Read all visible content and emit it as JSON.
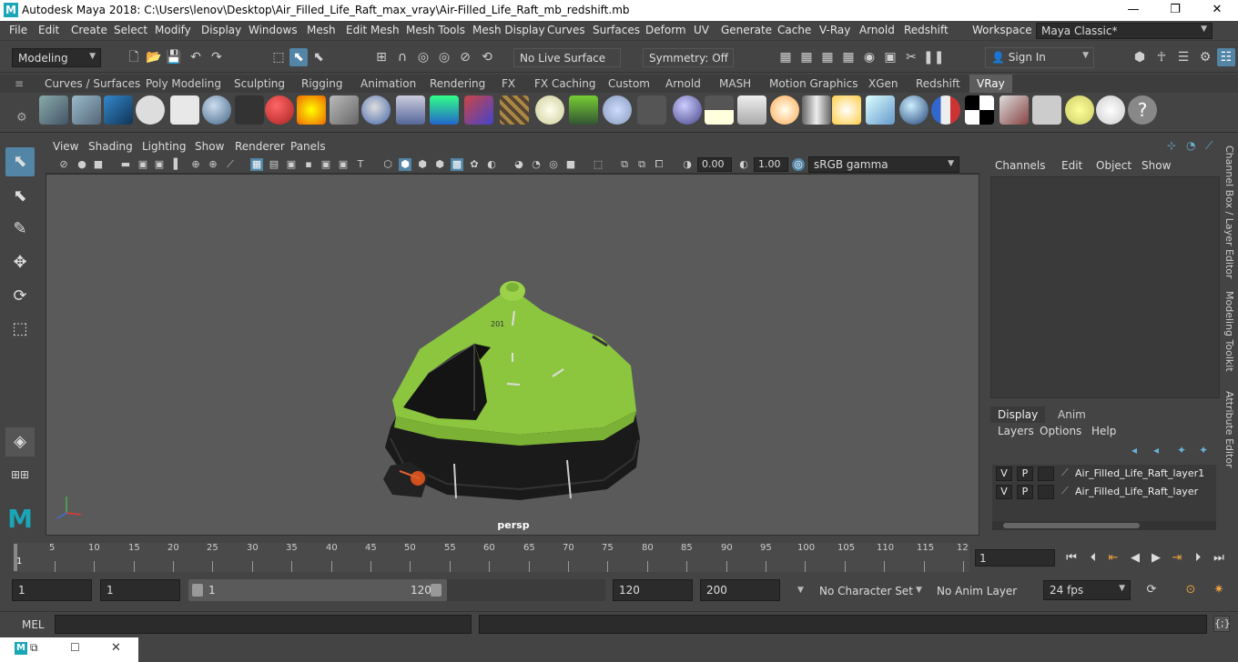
{
  "window": {
    "title": "Autodesk Maya 2018: C:\\Users\\lenov\\Desktop\\Air_Filled_Life_Raft_max_vray\\Air-Filled_Life_Raft_mb_redshift.mb",
    "logo": "M",
    "minimize": "—",
    "restore": "❐",
    "close": "✕"
  },
  "menubar": {
    "items": [
      "File",
      "Edit",
      "Create",
      "Select",
      "Modify",
      "Display",
      "Windows",
      "Mesh",
      "Edit Mesh",
      "Mesh Tools",
      "Mesh Display",
      "Curves",
      "Surfaces",
      "Deform",
      "UV",
      "Generate",
      "Cache",
      "V-Ray",
      "Arnold",
      "Redshift"
    ],
    "workspace_label": "Workspace :",
    "workspace_value": "Maya Classic*"
  },
  "statusline": {
    "mode": "Modeling",
    "live_surface": "No Live Surface",
    "symmetry": "Symmetry: Off",
    "sign_in": "Sign In"
  },
  "shelf": {
    "tabs": [
      "Curves / Surfaces",
      "Poly Modeling",
      "Sculpting",
      "Rigging",
      "Animation",
      "Rendering",
      "FX",
      "FX Caching",
      "Custom",
      "Arnold",
      "MASH",
      "Motion Graphics",
      "XGen",
      "Redshift",
      "VRay"
    ],
    "active_tab": "VRay"
  },
  "viewport": {
    "menus": [
      "View",
      "Shading",
      "Lighting",
      "Show",
      "Renderer",
      "Panels"
    ],
    "exposure": "0.00",
    "gamma": "1.00",
    "color_space": "sRGB gamma",
    "camera_label": "persp",
    "model_label": "201"
  },
  "channelbox": {
    "menus": [
      "Channels",
      "Edit",
      "Object",
      "Show"
    ]
  },
  "layers": {
    "tabs": [
      "Display",
      "Anim"
    ],
    "menus": [
      "Layers",
      "Options",
      "Help"
    ],
    "rows": [
      {
        "v": "V",
        "p": "P",
        "name": "Air_Filled_Life_Raft_layer1"
      },
      {
        "v": "V",
        "p": "P",
        "name": "Air_Filled_Life_Raft_layer"
      }
    ]
  },
  "sidetabs": [
    "Channel Box / Layer Editor",
    "Modeling Toolkit",
    "Attribute Editor"
  ],
  "timeslider": {
    "ticks": [
      "5",
      "10",
      "15",
      "20",
      "25",
      "30",
      "35",
      "40",
      "45",
      "50",
      "55",
      "60",
      "65",
      "70",
      "75",
      "80",
      "85",
      "90",
      "95",
      "100",
      "105",
      "110",
      "115",
      "12"
    ],
    "current_marker": "1",
    "current_frame": "1"
  },
  "range": {
    "start": "1",
    "playback_start": "1",
    "slider_start": "1",
    "slider_end": "120",
    "playback_end": "120",
    "end": "200",
    "character_set": "No Character Set",
    "anim_layer": "No Anim Layer",
    "fps": "24 fps"
  },
  "cmdline": {
    "label": "MEL"
  },
  "colors": {
    "accent": "#5285a6",
    "raft_green": "#8cc63f",
    "raft_black": "#1a1a1a"
  }
}
